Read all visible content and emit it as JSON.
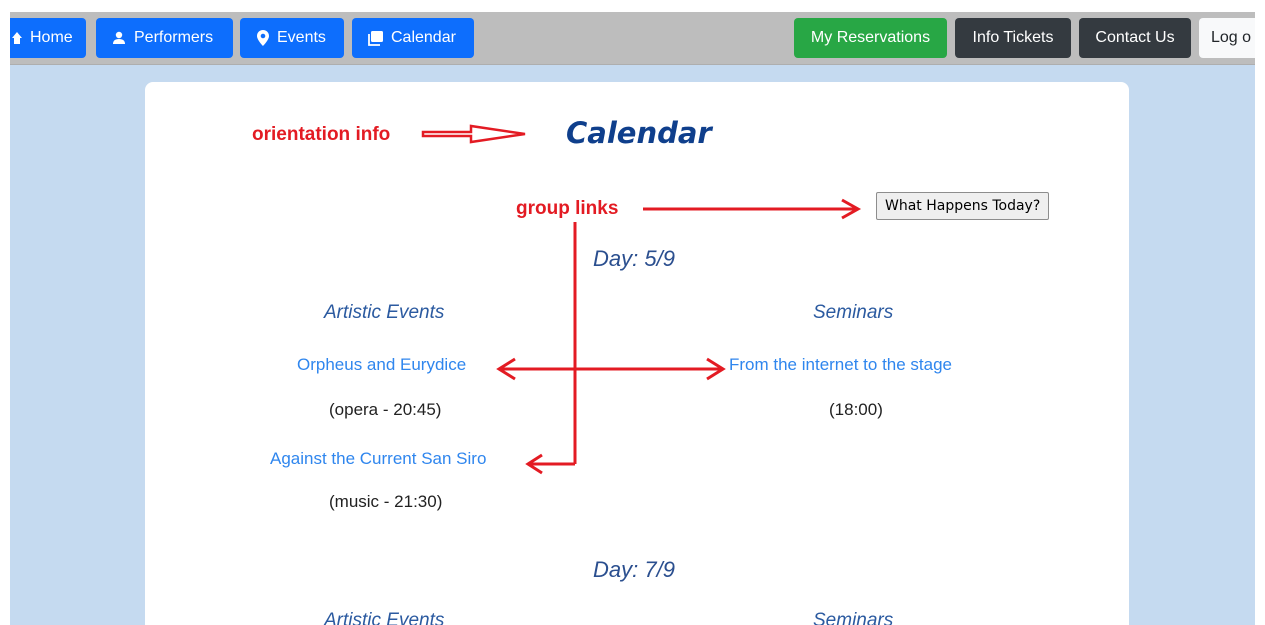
{
  "nav": {
    "home": "Home",
    "performers": "Performers",
    "events": "Events",
    "calendar": "Calendar",
    "reservations": "My Reservations",
    "info_tickets": "Info Tickets",
    "contact": "Contact Us",
    "logout": "Log o"
  },
  "page": {
    "title": "Calendar",
    "today_button": "What Happens Today?"
  },
  "annotations": {
    "orientation": "orientation info",
    "group": "group links"
  },
  "days": [
    {
      "label": "Day: 5/9",
      "artistic_heading": "Artistic Events",
      "seminars_heading": "Seminars",
      "artistic": [
        {
          "title": "Orpheus and Eurydice",
          "info": "(opera - 20:45)"
        },
        {
          "title": "Against the Current San Siro",
          "info": "(music - 21:30)"
        }
      ],
      "seminars": [
        {
          "title": "From the internet to the stage",
          "info": "(18:00)"
        }
      ]
    },
    {
      "label": "Day: 7/9",
      "artistic_heading": "Artistic Events",
      "seminars_heading": "Seminars"
    }
  ],
  "colors": {
    "background": "#c5daf0",
    "nav_blue": "#0d6efd",
    "nav_green": "#28a745",
    "nav_dark": "#343a40",
    "annotation_red": "#e31b23"
  }
}
